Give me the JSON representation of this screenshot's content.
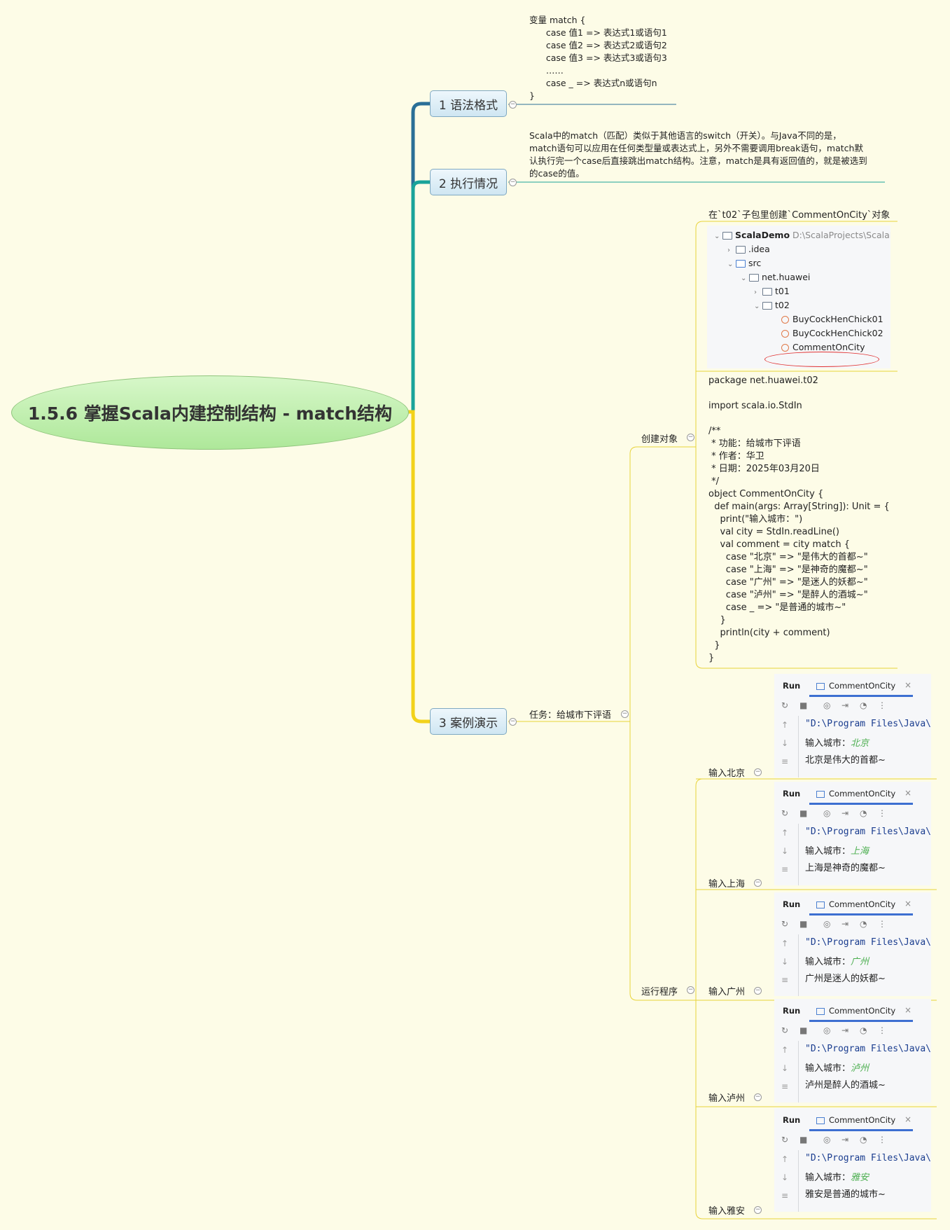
{
  "root": {
    "title": "1.5.6 掌握Scala内建控制结构 - match结构"
  },
  "branches": [
    {
      "label": "1 语法格式"
    },
    {
      "label": "2 执行情况"
    },
    {
      "label": "3 案例演示"
    }
  ],
  "syntax_note": "变量 match {\n      case 值1 => 表达式1或语句1\n      case 值2 => 表达式2或语句2\n      case 值3 => 表达式3或语句3\n      ……\n      case _ => 表达式n或语句n\n}",
  "exec_note": "Scala中的match（匹配）类似于其他语言的switch（开关）。与Java不同的是，\nmatch语句可以应用在任何类型量或表达式上，另外不需要调用break语句，match默\n认执行完一个case后直接跳出match结构。注意，match是具有返回值的，就是被选到\n的case的值。",
  "task": {
    "label": "任务：给城市下评语"
  },
  "create": {
    "label": "创建对象",
    "caption": "在`t02`子包里创建`CommentOnCity`对象",
    "tree": {
      "project": "ScalaDemo",
      "project_path": "D:\\ScalaProjects\\ScalaDemo",
      "items": [
        "ScalaDemo",
        ".idea",
        "src",
        "net.huawei",
        "t01",
        "t02",
        "BuyCockHenChick01",
        "BuyCockHenChick02",
        "CommentOnCity"
      ]
    },
    "code": "package net.huawei.t02\n\nimport scala.io.StdIn\n\n/**\n * 功能：给城市下评语\n * 作者：华卫\n * 日期：2025年03月20日\n */\nobject CommentOnCity {\n  def main(args: Array[String]): Unit = {\n    print(\"输入城市：\")\n    val city = StdIn.readLine()\n    val comment = city match {\n      case \"北京\" => \"是伟大的首都~\"\n      case \"上海\" => \"是神奇的魔都~\"\n      case \"广州\" => \"是迷人的妖都~\"\n      case \"泸州\" => \"是醉人的酒城~\"\n      case _ => \"是普通的城市~\"\n    }\n    println(city + comment)\n  }\n}"
  },
  "run": {
    "label": "运行程序",
    "panel_run": "Run",
    "panel_tab": "CommentOnCity",
    "cmd": "\"D:\\Program Files\\Java\\",
    "prompt": "输入城市：",
    "cases": [
      {
        "label": "输入北京",
        "input": "北京",
        "output": "北京是伟大的首都~"
      },
      {
        "label": "输入上海",
        "input": "上海",
        "output": "上海是神奇的魔都~"
      },
      {
        "label": "输入广州",
        "input": "广州",
        "output": "广州是迷人的妖都~"
      },
      {
        "label": "输入泸州",
        "input": "泸州",
        "output": "泸州是醉人的酒城~"
      },
      {
        "label": "输入雅安",
        "input": "雅安",
        "output": "雅安是普通的城市~"
      }
    ]
  },
  "colors": {
    "branch1": "#2a6f97",
    "branch2": "#1aa39a",
    "branch3": "#f2d21a",
    "sub": "#f2d21a",
    "root_fill": "#bdf0ab"
  }
}
